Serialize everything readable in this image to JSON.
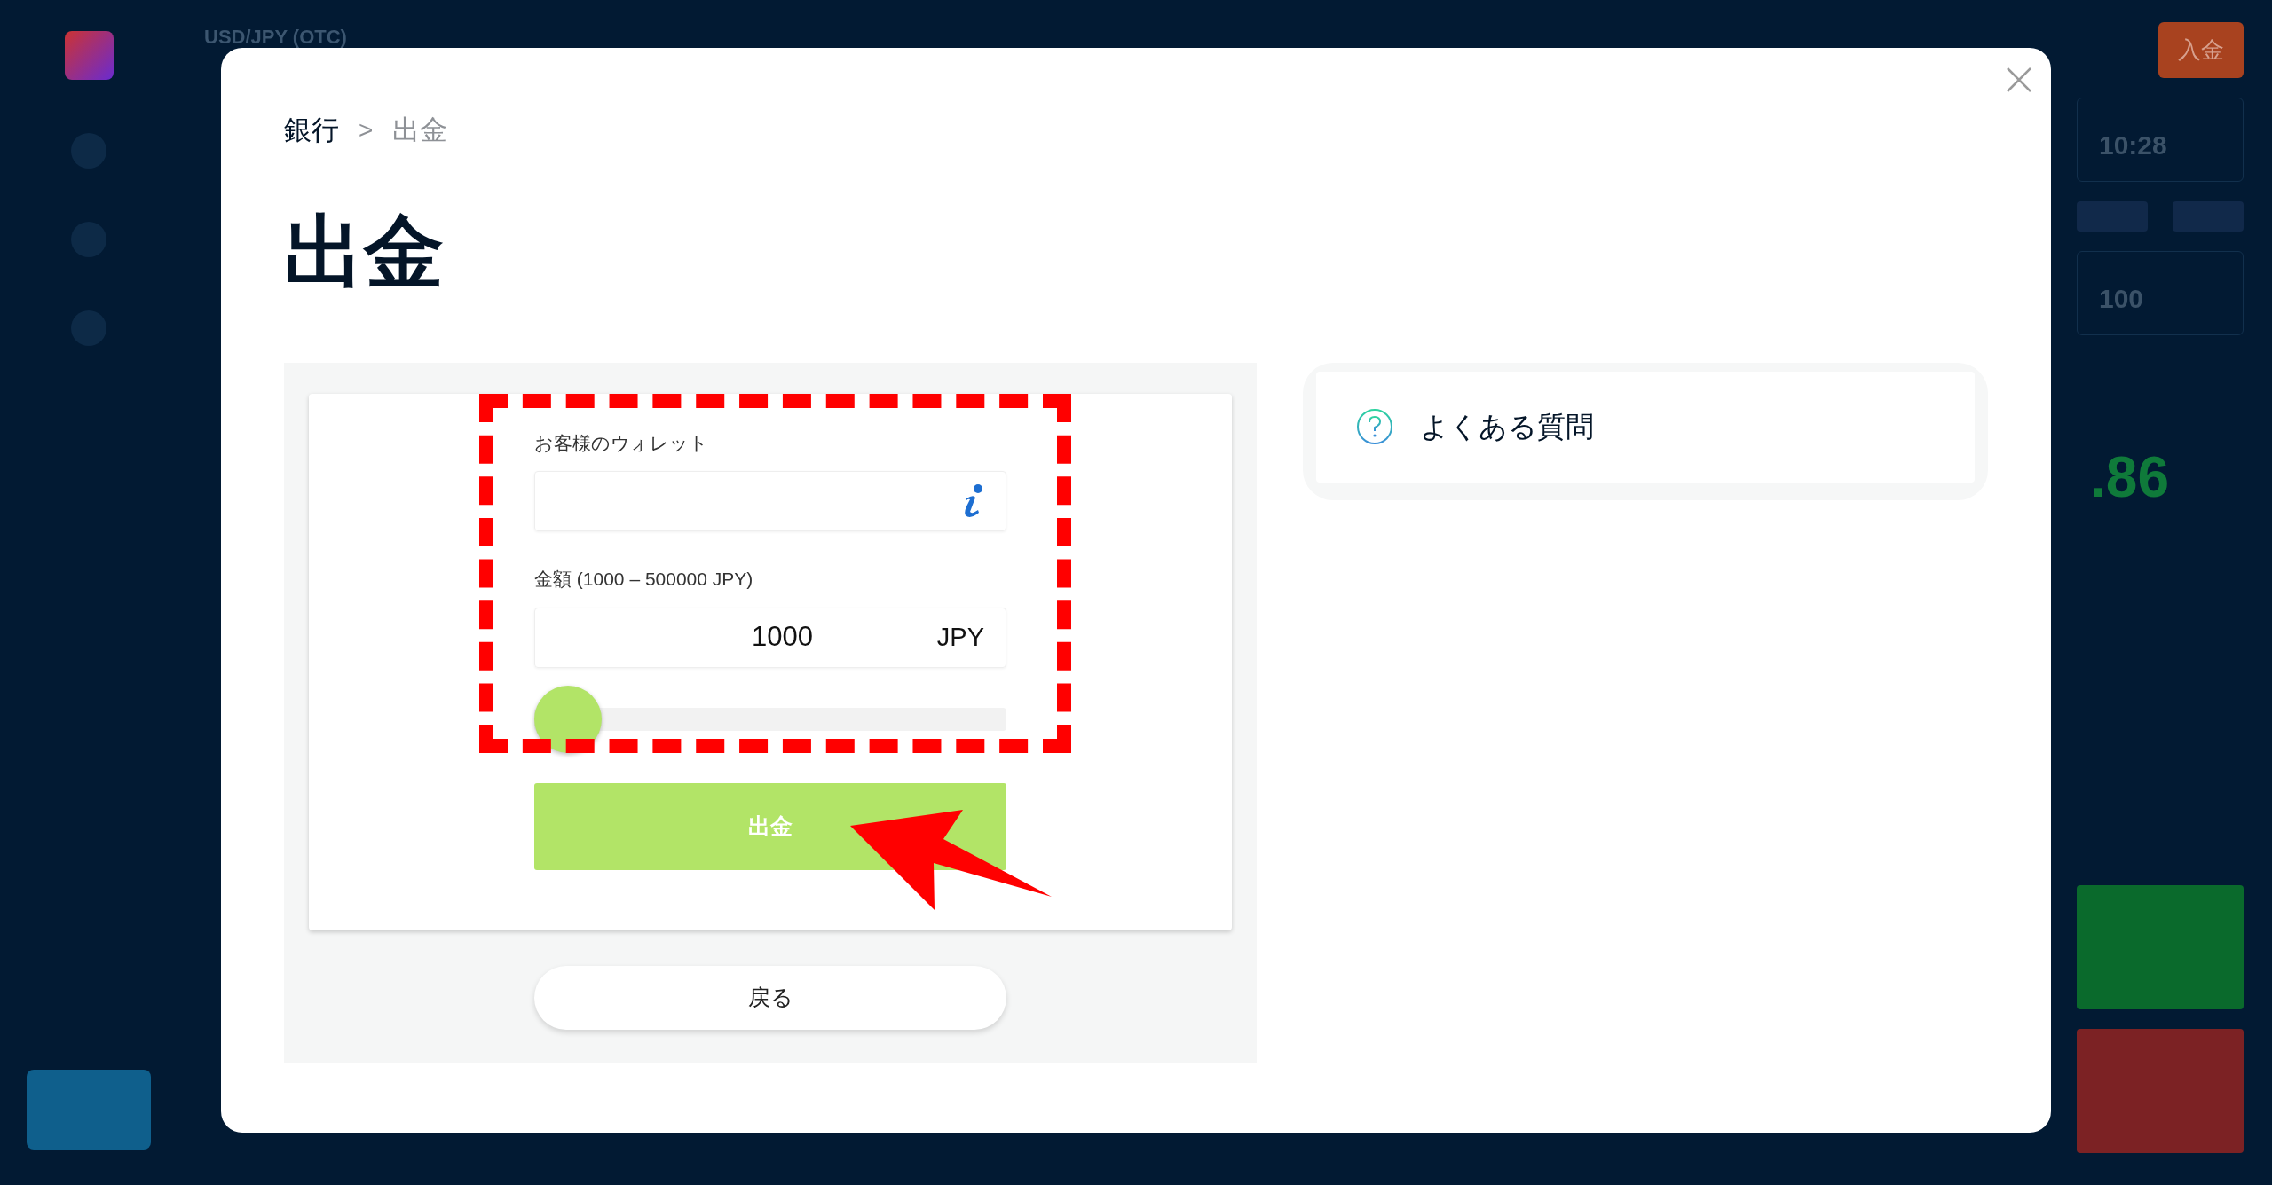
{
  "background": {
    "pair": "USD/JPY (OTC)",
    "deposit_button": "入金",
    "time": "10:28",
    "amount": "100",
    "payout": ".86"
  },
  "modal": {
    "breadcrumb": [
      {
        "label": "銀行",
        "current": false
      },
      {
        "label": "出金",
        "current": true
      }
    ],
    "separator": ">",
    "title": "出金",
    "form": {
      "wallet_label": "お客様のウォレット",
      "amount_label": "金額 (1000 – 500000 JPY)",
      "amount_value": "1000",
      "currency": "JPY",
      "slider": {
        "level": 0
      },
      "submit": "出金"
    },
    "back": "戻る",
    "faq": {
      "label": "よくある質問"
    }
  },
  "annotations": {
    "highlight_frame": true,
    "arrow": true
  }
}
